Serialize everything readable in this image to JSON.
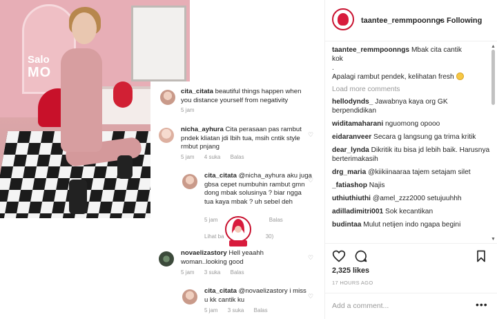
{
  "photo": {
    "salon_line1": "Salo",
    "salon_line2": "MO"
  },
  "collage": {
    "comments": [
      {
        "user": "cita_citata",
        "text": "beautiful things happen when you distance yourself from negativity",
        "time": "5 jam"
      },
      {
        "user": "nicha_ayhura",
        "text": "Cita perasaan pas rambut pndek kliatan jdi lbih tua,  msih cntik style rmbut pnjang",
        "time": "5 jam",
        "likes": "4 suka",
        "reply": "Balas"
      },
      {
        "user": "cita_citata",
        "text": "@nicha_ayhura aku juga gbsa cepet numbuhin rambut gmn dong mbak solusinya ? biar ngga tua kaya mbak ? uh sebel deh",
        "time": "5 jam",
        "reply": "Balas"
      },
      {
        "user": "novaelizastory",
        "text": "Hell yeaahh woman..looking good",
        "time": "5 jam",
        "likes": "3 suka",
        "reply": "Balas"
      },
      {
        "user": "cita_citata",
        "text": "@novaelizastory i miss u kk cantik ku",
        "time": "5 jam",
        "likes": "3 suka",
        "reply": "Balas"
      }
    ],
    "view_replies": "Lihat ba",
    "view_replies_count": "30)"
  },
  "header": {
    "username": "taantee_remmpoonngs",
    "separator": "•",
    "follow_label": "Following"
  },
  "caption": {
    "user": "taantee_remmpoonngs",
    "line1": "Mbak cita cantik",
    "line2": "kok",
    "line3": ".",
    "line4": "Apalagi rambut pendek, kelihatan fresh"
  },
  "load_more": "Load more comments",
  "feed_comments": [
    {
      "user": "hellodynds_",
      "text": "Jawabnya kaya org GK berpendidikan"
    },
    {
      "user": "widitamaharani",
      "text": "nguomong opooo"
    },
    {
      "user": "eidaranveer",
      "text": "Secara g langsung ga trima kritik"
    },
    {
      "user": "dear_lynda",
      "text": "Dikritik itu bisa jd lebih baik. Harusnya berterimakasih"
    },
    {
      "user": "drg_maria",
      "text": "@kiikiinaaraa tajem setajam silet"
    },
    {
      "user": "_fatiashop",
      "text": "Najis"
    },
    {
      "user": "uthiuthiuthi",
      "text": "@amel_zzz2000 setujuuhhh"
    },
    {
      "user": "adilladimitri001",
      "text": "Sok kecantikan"
    },
    {
      "user": "budintaa",
      "text": "Mulut netijen indo ngapa begini"
    }
  ],
  "likes_text": "2,325 likes",
  "timestamp": "17 HOURS AGO",
  "add_comment_placeholder": "Add a comment...",
  "more_label": "•••",
  "icons": {
    "heart": "heart-icon",
    "comment": "comment-icon",
    "save": "bookmark-icon"
  }
}
